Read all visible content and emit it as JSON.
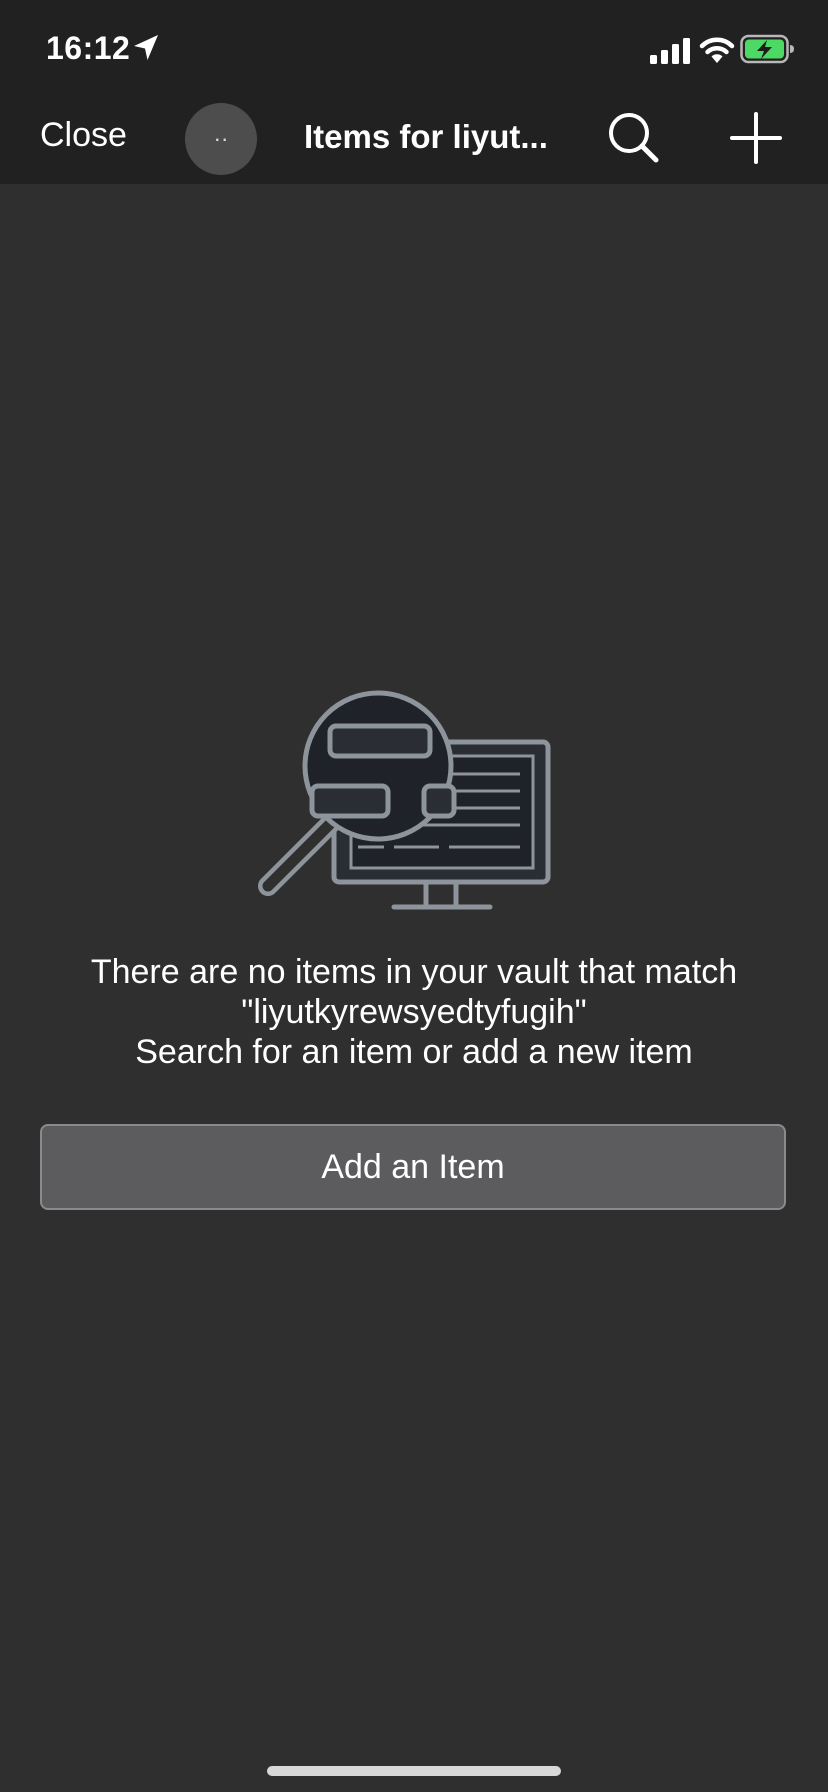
{
  "status_bar": {
    "time": "16:12",
    "icons": [
      "location-arrow-icon",
      "cellular-signal-icon",
      "wifi-icon",
      "battery-charging-icon"
    ],
    "battery_color": "#4cd964"
  },
  "nav_bar": {
    "close_label": "Close",
    "avatar_text": "··",
    "title": "Items for liyut...",
    "icons": [
      "search-icon",
      "plus-icon"
    ]
  },
  "empty_state": {
    "illustration": "magnifier-over-monitor-illustration",
    "message_line1": "There are no items in your vault that match",
    "message_line2": "\"liyutkyrewsyedtyfugih\"",
    "message_line3": "Search for an item or add a new item",
    "button_label": "Add an Item"
  },
  "colors": {
    "background": "#2f2f2f",
    "bars": "#212121",
    "button": "#5c5c5e",
    "illustration_stroke": "#8e949c",
    "illustration_fill": "#1f2228"
  }
}
